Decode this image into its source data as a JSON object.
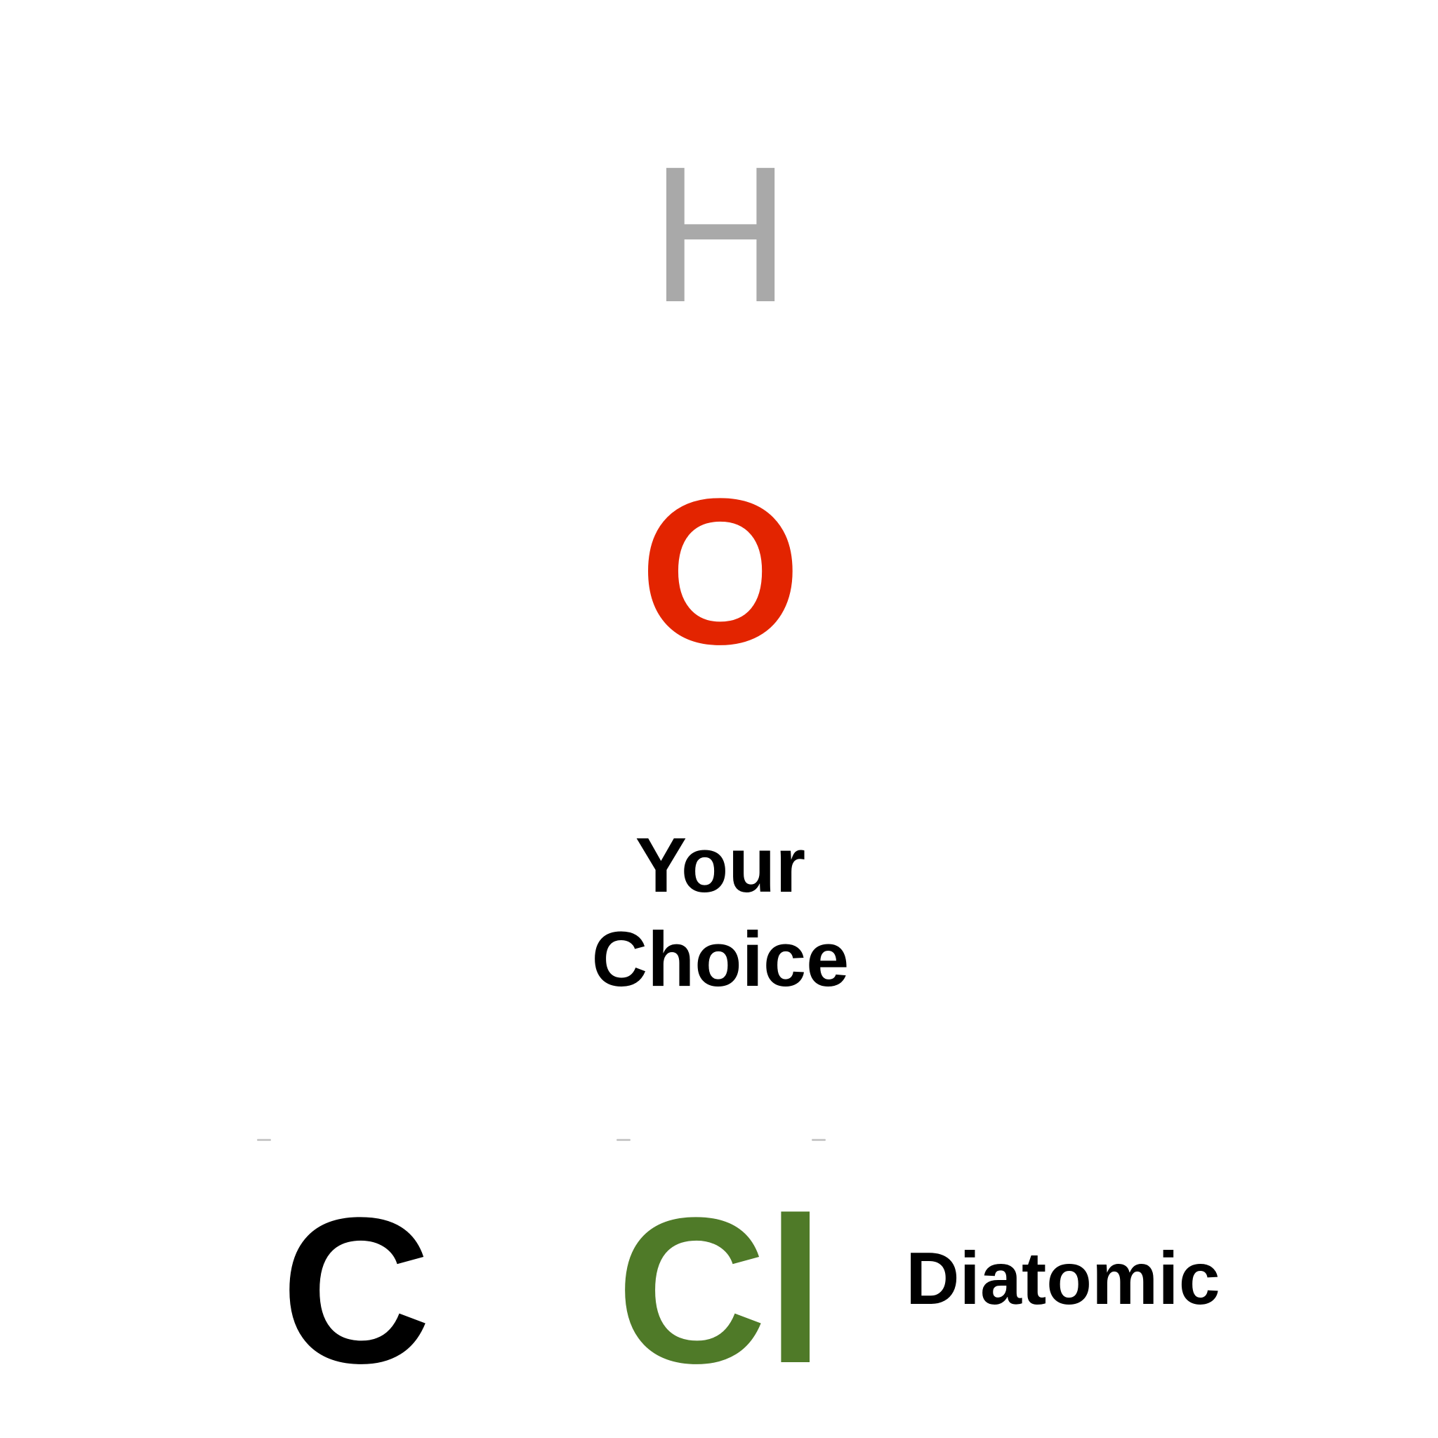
{
  "elements": {
    "h": {
      "symbol": "H",
      "color": "#a9a9a9"
    },
    "o": {
      "symbol": "O",
      "color": "#e32400"
    },
    "c": {
      "symbol": "C",
      "color": "#000000"
    },
    "cl": {
      "symbol": "Cl",
      "color": "#4f7a28"
    }
  },
  "labels": {
    "your_choice_line1": "Your",
    "your_choice_line2": "Choice",
    "diatomic": "Diatomic"
  }
}
